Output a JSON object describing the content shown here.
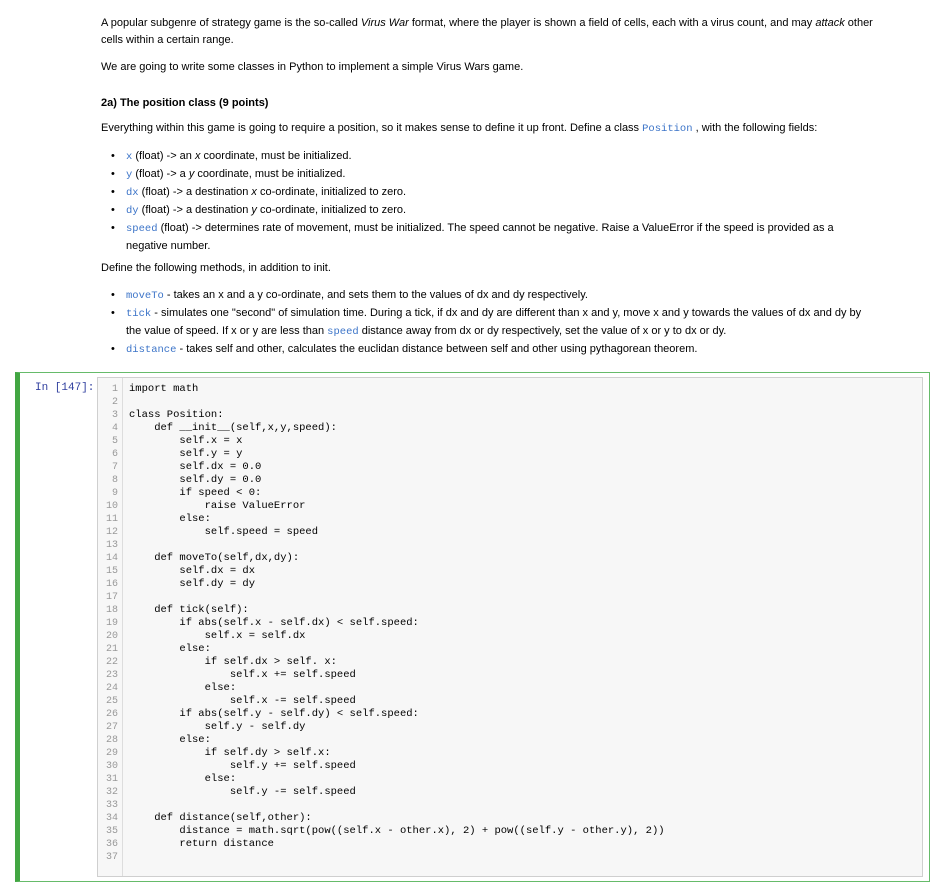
{
  "markdown": {
    "intro_line1": "A popular subgenre of strategy game is the so-called ",
    "intro_italic": "Virus War",
    "intro_line1b": " format, where the player is shown a field of cells, each with a virus count, and may ",
    "intro_attack": "attack",
    "intro_line1c": " other",
    "intro_line2": "cells within a certain range.",
    "para2": "We are going to write some classes in Python to implement a simple Virus Wars game.",
    "heading": "2a) The position class (9 points)",
    "para3a": "Everything within this game is going to require a position, so it makes sense to define it up front. Define a class ",
    "para3_code": "Position",
    "para3b": " , with the following fields:",
    "fields": [
      {
        "code": "x",
        "text": " (float) -> an ",
        "ital": "x",
        "tail": " coordinate, must be initialized."
      },
      {
        "code": "y",
        "text": " (float) -> a ",
        "ital": "y",
        "tail": " coordinate, must be initialized."
      },
      {
        "code": "dx",
        "text": " (float) -> a destination ",
        "ital": "x",
        "tail": " co-ordinate, initialized to zero."
      },
      {
        "code": "dy",
        "text": " (float) -> a destination ",
        "ital": "y",
        "tail": " co-ordinate, initialized to zero."
      }
    ],
    "speed_code": "speed",
    "speed_line1": " (float) -> determines rate of movement, must be initialized. The speed cannot be negative. Raise a ValueError if the speed is provided as a",
    "speed_line2": "negative number.",
    "para4": "Define the following methods, in addition to init.",
    "m1_code": "moveTo",
    "m1_text": " - takes an x and a y co-ordinate, and sets them to the values of dx and dy respectively.",
    "m2_code": "tick",
    "m2_text1": " - simulates one \"second\" of simulation time. During a tick, if dx and dy are different than x and y, move x and y towards the values of dx and dy by",
    "m2_text2a": "the value of speed. If x or y are less than ",
    "m2_code2": "speed",
    "m2_text2b": " distance away from dx or dy respectively, set the value of x or y to dx or dy.",
    "m3_code": "distance",
    "m3_text": " - takes self and other, calculates the euclidan distance between self and other using pythagorean theorem."
  },
  "cell": {
    "prompt": "In [147]:",
    "line_numbers": [
      "1",
      "2",
      "3",
      "4",
      "5",
      "6",
      "7",
      "8",
      "9",
      "10",
      "11",
      "12",
      "13",
      "14",
      "15",
      "16",
      "17",
      "18",
      "19",
      "20",
      "21",
      "22",
      "23",
      "24",
      "25",
      "26",
      "27",
      "28",
      "29",
      "30",
      "31",
      "32",
      "33",
      "34",
      "35",
      "36",
      "37"
    ],
    "lines": [
      "import math",
      "",
      "class Position:",
      "    def __init__(self,x,y,speed):",
      "        self.x = x",
      "        self.y = y",
      "        self.dx = 0.0",
      "        self.dy = 0.0",
      "        if speed < 0:",
      "            raise ValueError",
      "        else:",
      "            self.speed = speed",
      "",
      "    def moveTo(self,dx,dy):",
      "        self.dx = dx",
      "        self.dy = dy",
      "",
      "    def tick(self):",
      "        if abs(self.x - self.dx) < self.speed:",
      "            self.x = self.dx",
      "        else:",
      "            if self.dx > self. x:",
      "                self.x += self.speed",
      "            else:",
      "                self.x -= self.speed",
      "        if abs(self.y - self.dy) < self.speed:",
      "            self.y - self.dy",
      "        else:",
      "            if self.dy > self.x:",
      "                self.y += self.speed",
      "            else:",
      "                self.y -= self.speed",
      "",
      "    def distance(self,other):",
      "        distance = math.sqrt(pow((self.x - other.x), 2) + pow((self.y - other.y), 2))",
      "        return distance",
      ""
    ]
  }
}
